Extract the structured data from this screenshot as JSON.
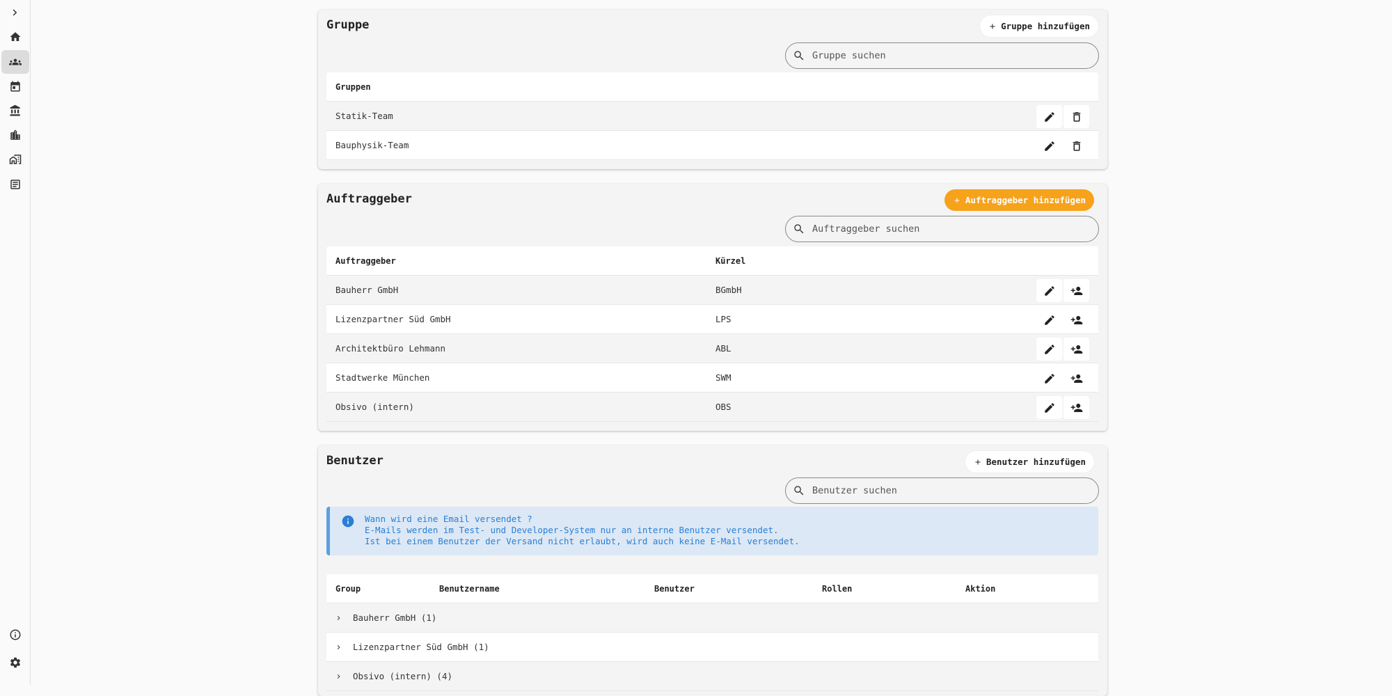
{
  "sidebar": {
    "items": [
      {
        "icon": "chevron-right-icon"
      },
      {
        "icon": "home-icon"
      },
      {
        "icon": "groups-icon",
        "active": true
      },
      {
        "icon": "calendar-icon"
      },
      {
        "icon": "bank-icon"
      },
      {
        "icon": "building-icon"
      },
      {
        "icon": "domain-icon"
      },
      {
        "icon": "notes-icon"
      }
    ],
    "bottom": [
      {
        "icon": "info-icon"
      },
      {
        "icon": "settings-icon"
      }
    ]
  },
  "gruppe": {
    "title": "Gruppe",
    "add_label": "Gruppe hinzufügen",
    "search_placeholder": "Gruppe suchen",
    "column": "Gruppen",
    "rows": [
      "Statik-Team",
      "Bauphysik-Team"
    ]
  },
  "auftraggeber": {
    "title": "Auftraggeber",
    "add_label": "Auftraggeber hinzufügen",
    "search_placeholder": "Auftraggeber suchen",
    "columns": [
      "Auftraggeber",
      "Kürzel"
    ],
    "rows": [
      {
        "name": "Bauherr GmbH",
        "short": "BGmbH"
      },
      {
        "name": "Lizenzpartner Süd GmbH",
        "short": "LPS"
      },
      {
        "name": "Architektbüro Lehmann",
        "short": "ABL"
      },
      {
        "name": "Stadtwerke München",
        "short": "SWM"
      },
      {
        "name": "Obsivo (intern)",
        "short": "OBS"
      }
    ]
  },
  "benutzer": {
    "title": "Benutzer",
    "add_label": "Benutzer hinzufügen",
    "search_placeholder": "Benutzer suchen",
    "info_lines": [
      "Wann wird eine Email versendet ?",
      "E-Mails werden im Test- und Developer-System nur an interne Benutzer versendet.",
      "Ist bei einem Benutzer der Versand nicht erlaubt, wird auch keine E-Mail versendet."
    ],
    "columns": [
      "Group",
      "Benutzername",
      "Benutzer",
      "Rollen",
      "Aktion"
    ],
    "groups": [
      {
        "name": "Bauherr GmbH",
        "count": "(1)"
      },
      {
        "name": "Lizenzpartner Süd GmbH",
        "count": "(1)"
      },
      {
        "name": "Obsivo (intern)",
        "count": "(4)"
      }
    ]
  },
  "colors": {
    "accent": "#f7a21b",
    "info": "#2a7fd4",
    "info_bg": "#dce8f5"
  }
}
